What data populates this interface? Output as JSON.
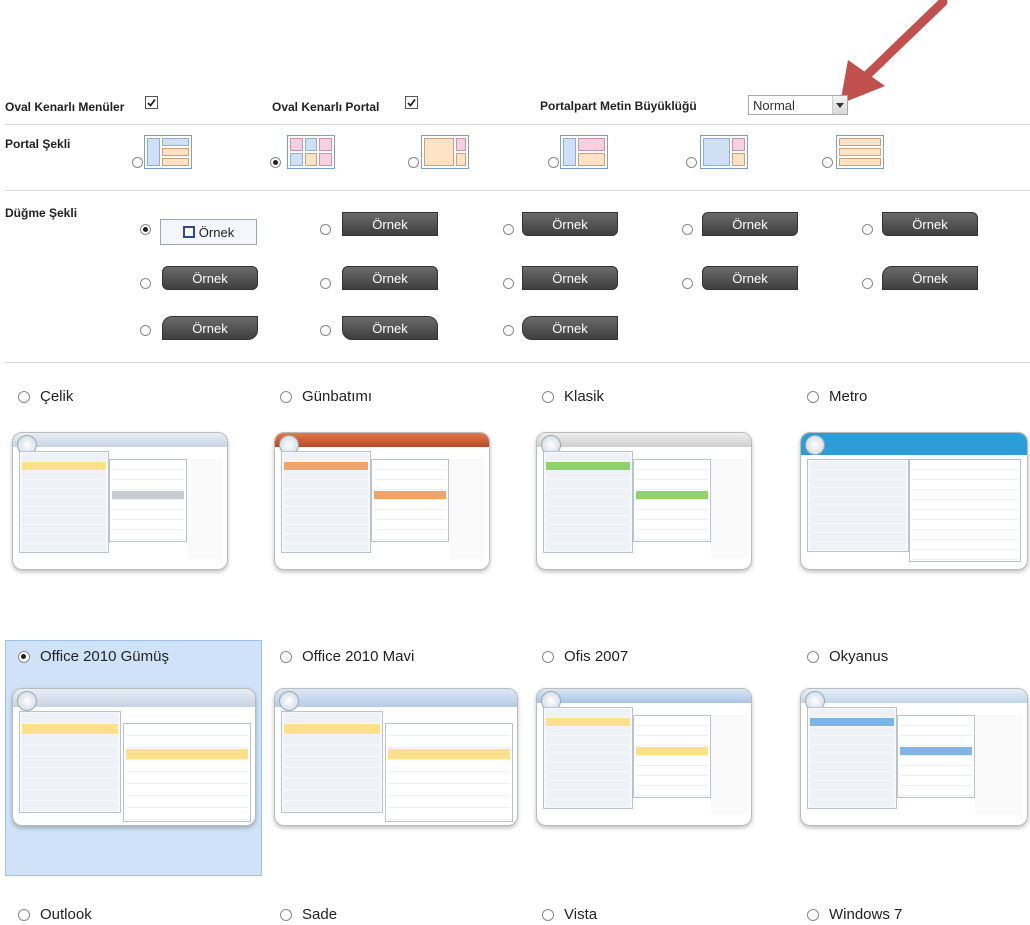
{
  "settings": {
    "oval_menu_label": "Oval Kenarlı Menüler",
    "oval_menu_checked": true,
    "oval_portal_label": "Oval Kenarlı Portal",
    "oval_portal_checked": true,
    "text_size_label": "Portalpart Metin Büyüklüğü",
    "text_size_value": "Normal"
  },
  "portal_shape": {
    "label": "Portal Şekli",
    "selected_index": 1
  },
  "button_shape": {
    "label": "Düğme Şekli",
    "sample_label": "Örnek",
    "selected_index": 0
  },
  "themes": {
    "items": [
      {
        "label": "Çelik",
        "selected": false
      },
      {
        "label": "Günbatımı",
        "selected": false
      },
      {
        "label": "Klasik",
        "selected": false
      },
      {
        "label": "Metro",
        "selected": false
      },
      {
        "label": "Office 2010 Gümüş",
        "selected": true
      },
      {
        "label": "Office 2010 Mavi",
        "selected": false
      },
      {
        "label": "Ofis 2007",
        "selected": false
      },
      {
        "label": "Okyanus",
        "selected": false
      },
      {
        "label": "Outlook",
        "selected": false
      },
      {
        "label": "Sade",
        "selected": false
      },
      {
        "label": "Vista",
        "selected": false
      },
      {
        "label": "Windows 7",
        "selected": false
      }
    ]
  },
  "colors": {
    "annotation_arrow": "#c0504d",
    "selected_theme_bg": "#cfe2f8",
    "dark_button": "#4a4a4a"
  }
}
